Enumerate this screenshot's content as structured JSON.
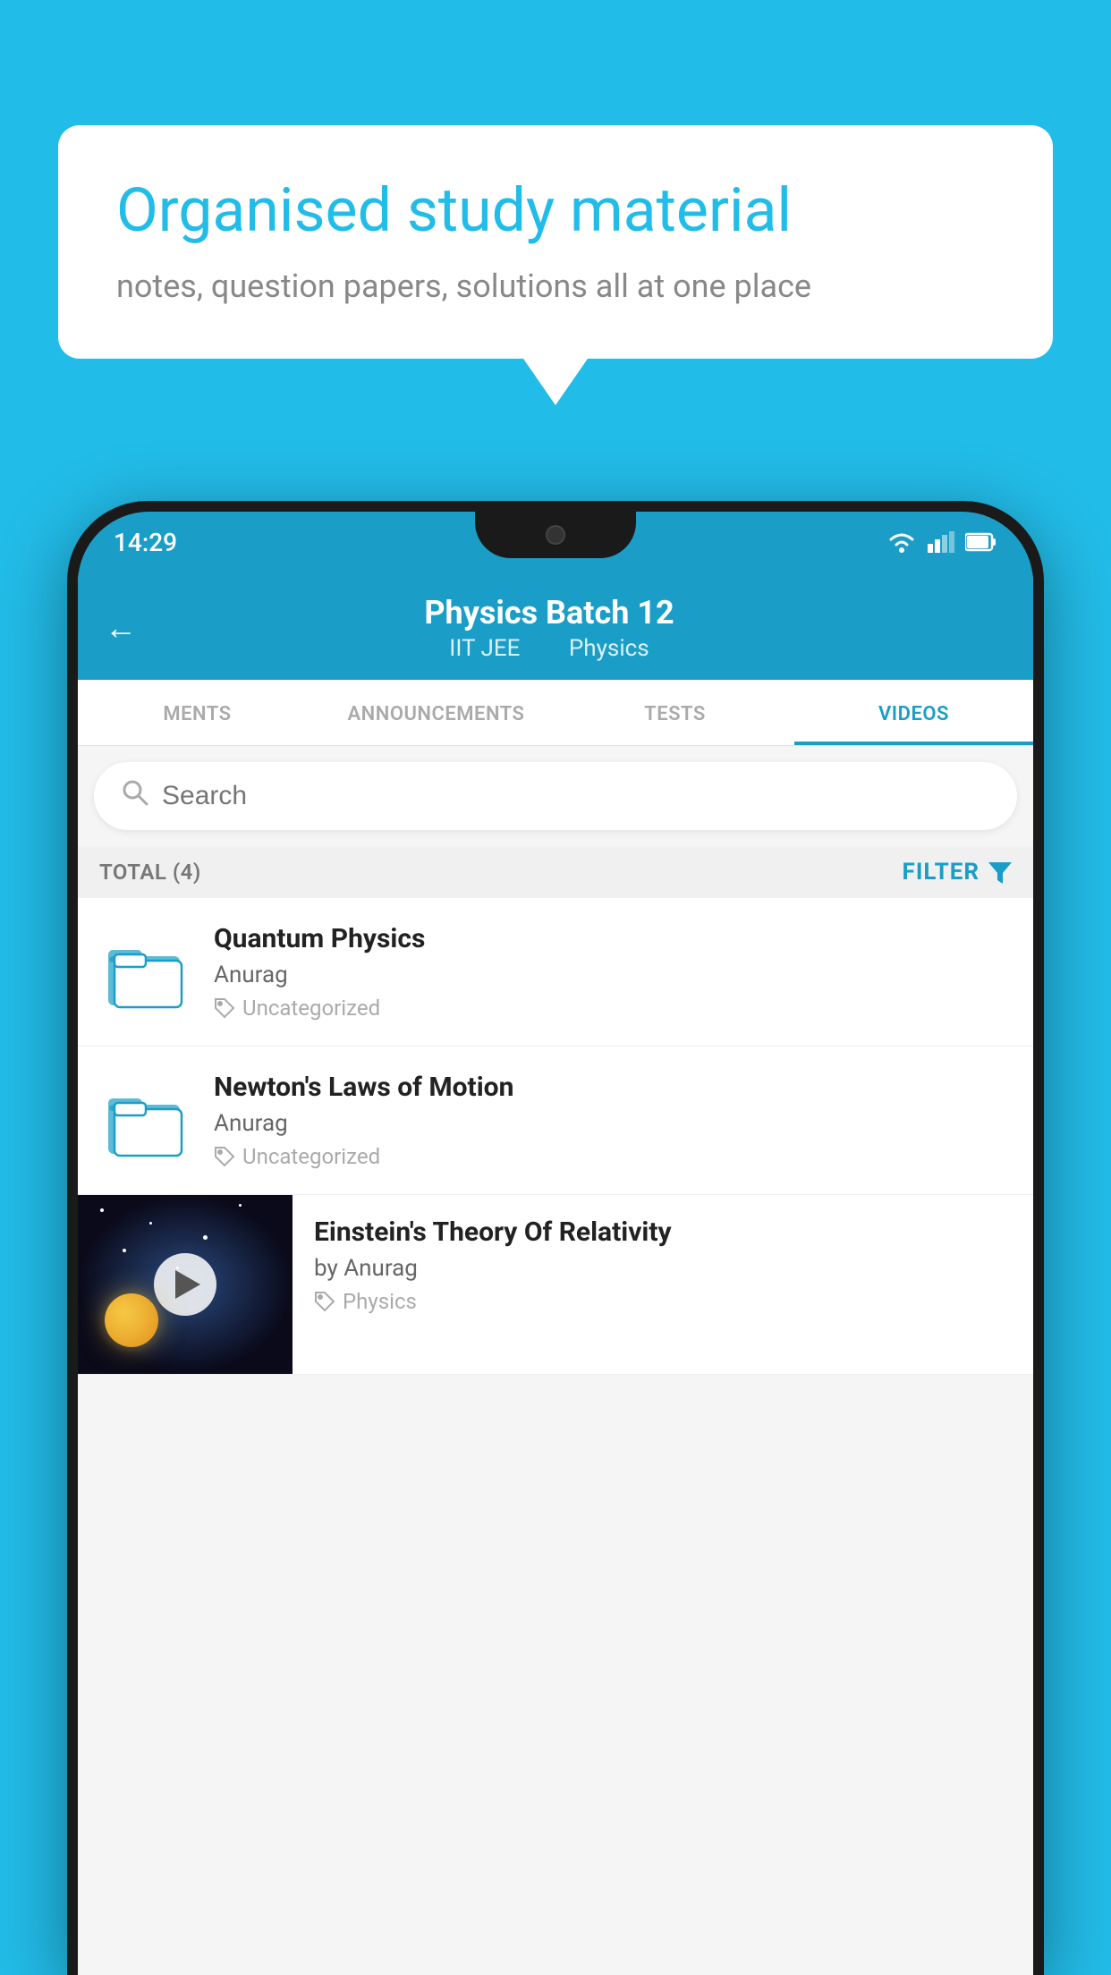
{
  "background_color": "#22bce8",
  "speech_bubble": {
    "title": "Organised study material",
    "subtitle": "notes, question papers, solutions all at one place"
  },
  "status_bar": {
    "time": "14:29",
    "wifi": "▾",
    "signal": "▴",
    "battery": "▮"
  },
  "header": {
    "back_label": "←",
    "title": "Physics Batch 12",
    "subtitle_part1": "IIT JEE",
    "subtitle_part2": "Physics"
  },
  "tabs": [
    {
      "label": "MENTS",
      "active": false
    },
    {
      "label": "ANNOUNCEMENTS",
      "active": false
    },
    {
      "label": "TESTS",
      "active": false
    },
    {
      "label": "VIDEOS",
      "active": true
    }
  ],
  "search": {
    "placeholder": "Search"
  },
  "filter_row": {
    "total_label": "TOTAL (4)",
    "filter_label": "FILTER"
  },
  "videos": [
    {
      "id": 1,
      "title": "Quantum Physics",
      "author": "Anurag",
      "tag": "Uncategorized",
      "type": "folder"
    },
    {
      "id": 2,
      "title": "Newton's Laws of Motion",
      "author": "Anurag",
      "tag": "Uncategorized",
      "type": "folder"
    },
    {
      "id": 3,
      "title": "Einstein's Theory Of Relativity",
      "author": "by Anurag",
      "tag": "Physics",
      "type": "video"
    }
  ]
}
